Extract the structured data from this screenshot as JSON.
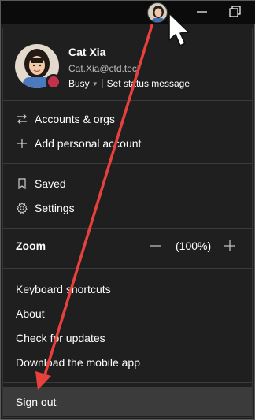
{
  "profile": {
    "name": "Cat Xia",
    "email": "Cat.Xia@ctd.tech",
    "status": "Busy",
    "status_message_action": "Set status message",
    "presence_color": "#c4314b"
  },
  "accounts": {
    "items": [
      {
        "icon": "switch-arrows-icon",
        "label": "Accounts & orgs"
      },
      {
        "icon": "plus-icon",
        "label": "Add personal account"
      }
    ]
  },
  "general": {
    "items": [
      {
        "icon": "bookmark-icon",
        "label": "Saved"
      },
      {
        "icon": "gear-icon",
        "label": "Settings"
      }
    ]
  },
  "zoom": {
    "label": "Zoom",
    "value": "(100%)"
  },
  "more": {
    "items": [
      {
        "label": "Keyboard shortcuts"
      },
      {
        "label": "About"
      },
      {
        "label": "Check for updates"
      },
      {
        "label": "Download the mobile app"
      }
    ]
  },
  "signout": {
    "label": "Sign out"
  },
  "annotation": {
    "arrow_color": "#e8413d"
  }
}
